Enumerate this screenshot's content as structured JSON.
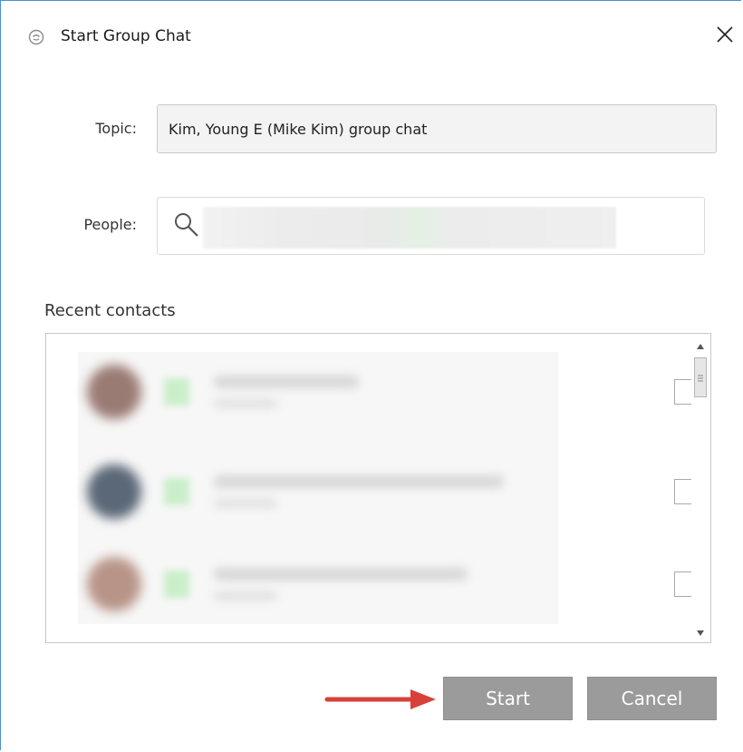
{
  "window": {
    "title": "Start Group Chat",
    "icons": {
      "app": "chat-bubble-icon",
      "close": "close-icon"
    }
  },
  "form": {
    "topic_label": "Topic:",
    "topic_value": "Kim, Young E (Mike Kim) group chat",
    "people_label": "People:",
    "people_value": "",
    "people_icon": "search-icon"
  },
  "contacts": {
    "label": "Recent contacts",
    "rows": [
      {
        "checked": false,
        "avatar_color": "#9a7b74"
      },
      {
        "checked": false,
        "avatar_color": "#5b6878"
      },
      {
        "checked": false,
        "avatar_color": "#b89488"
      }
    ]
  },
  "buttons": {
    "start_label": "Start",
    "cancel_label": "Cancel"
  },
  "colors": {
    "button_bg": "#9b9b9b",
    "annotation_arrow": "#d9403a",
    "window_border": "#4a8fd6"
  }
}
